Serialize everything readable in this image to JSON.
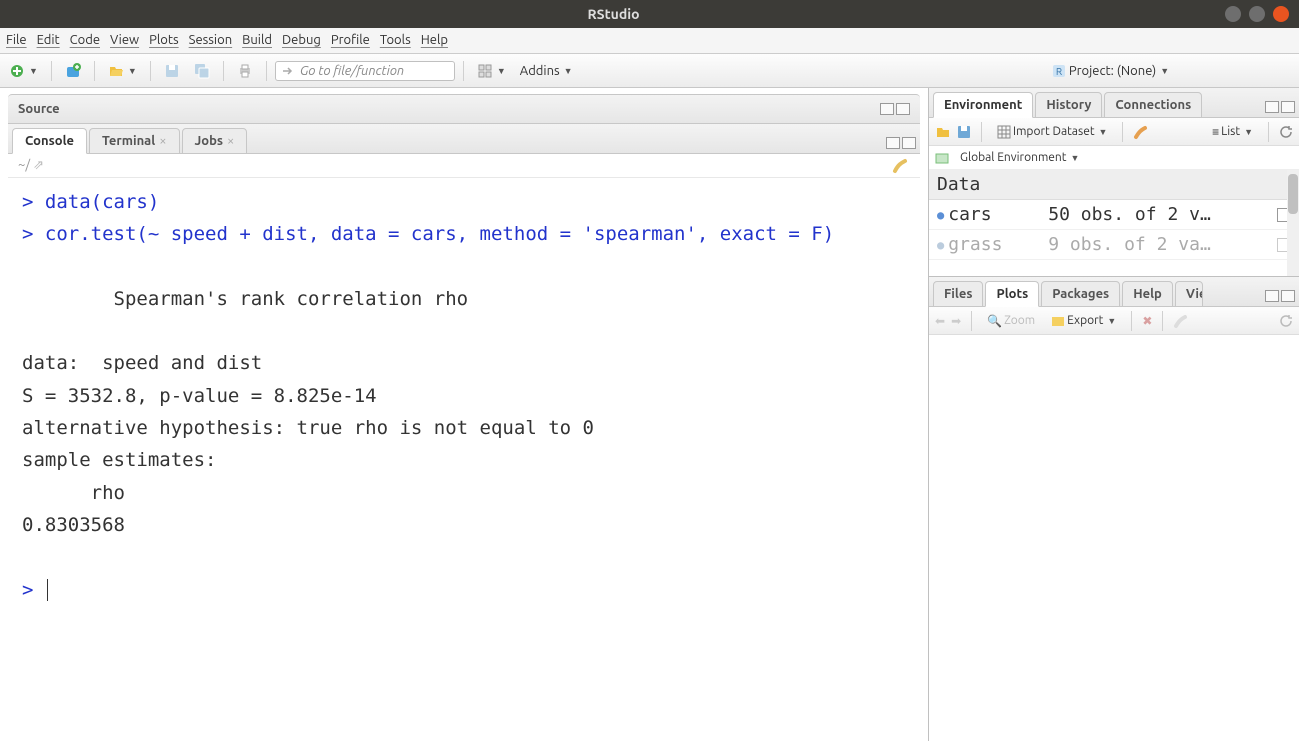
{
  "window": {
    "title": "RStudio"
  },
  "menu": [
    "File",
    "Edit",
    "Code",
    "View",
    "Plots",
    "Session",
    "Build",
    "Debug",
    "Profile",
    "Tools",
    "Help"
  ],
  "toolbar": {
    "goto_placeholder": "Go to file/function",
    "addins": "Addins",
    "project_label": "Project: (None)"
  },
  "left": {
    "source_header": "Source",
    "tabs": {
      "console": "Console",
      "terminal": "Terminal",
      "jobs": "Jobs"
    },
    "console_path": "~/",
    "console": {
      "line1": "> data(cars)",
      "line2": "> cor.test(~ speed + dist, data = cars, method = 'spearman', exact = F)",
      "out1": "        Spearman's rank correlation rho",
      "out2": "data:  speed and dist",
      "out3": "S = 3532.8, p-value = 8.825e-14",
      "out4": "alternative hypothesis: true rho is not equal to 0",
      "out5": "sample estimates:",
      "out6": "      rho ",
      "out7": "0.8303568 ",
      "prompt": "> "
    }
  },
  "right_top": {
    "tabs": [
      "Environment",
      "History",
      "Connections"
    ],
    "import": "Import Dataset",
    "list": "List",
    "scope": "Global Environment",
    "data_header": "Data",
    "rows": [
      {
        "name": "cars",
        "desc": "50 obs. of 2 v…"
      },
      {
        "name": "grass",
        "desc": "9 obs. of 2 va…"
      }
    ]
  },
  "right_bottom": {
    "tabs": [
      "Files",
      "Plots",
      "Packages",
      "Help",
      "Viewer"
    ],
    "zoom": "Zoom",
    "export": "Export"
  }
}
